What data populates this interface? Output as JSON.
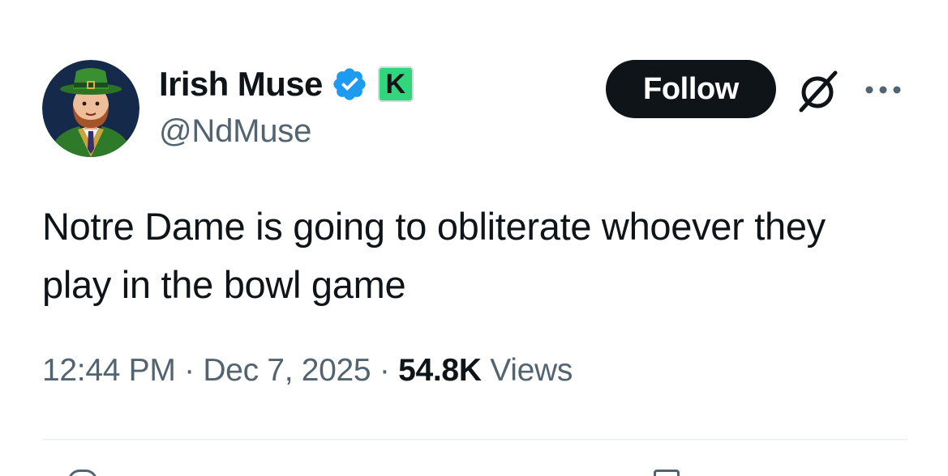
{
  "author": {
    "display_name": "Irish Muse",
    "handle": "@NdMuse",
    "verified": true,
    "badge_letter": "K",
    "verified_color": "#1d9bf0",
    "badge_color": "#31d57c"
  },
  "header": {
    "follow_label": "Follow",
    "grok_icon": "grok-icon",
    "more_icon": "more-icon"
  },
  "tweet": {
    "text": "Notre Dame is going to obliterate whoever they play in the bowl game"
  },
  "meta": {
    "time": "12:44 PM",
    "separator": "·",
    "date": "Dec 7, 2025",
    "views_count": "54.8K",
    "views_label": "Views"
  }
}
